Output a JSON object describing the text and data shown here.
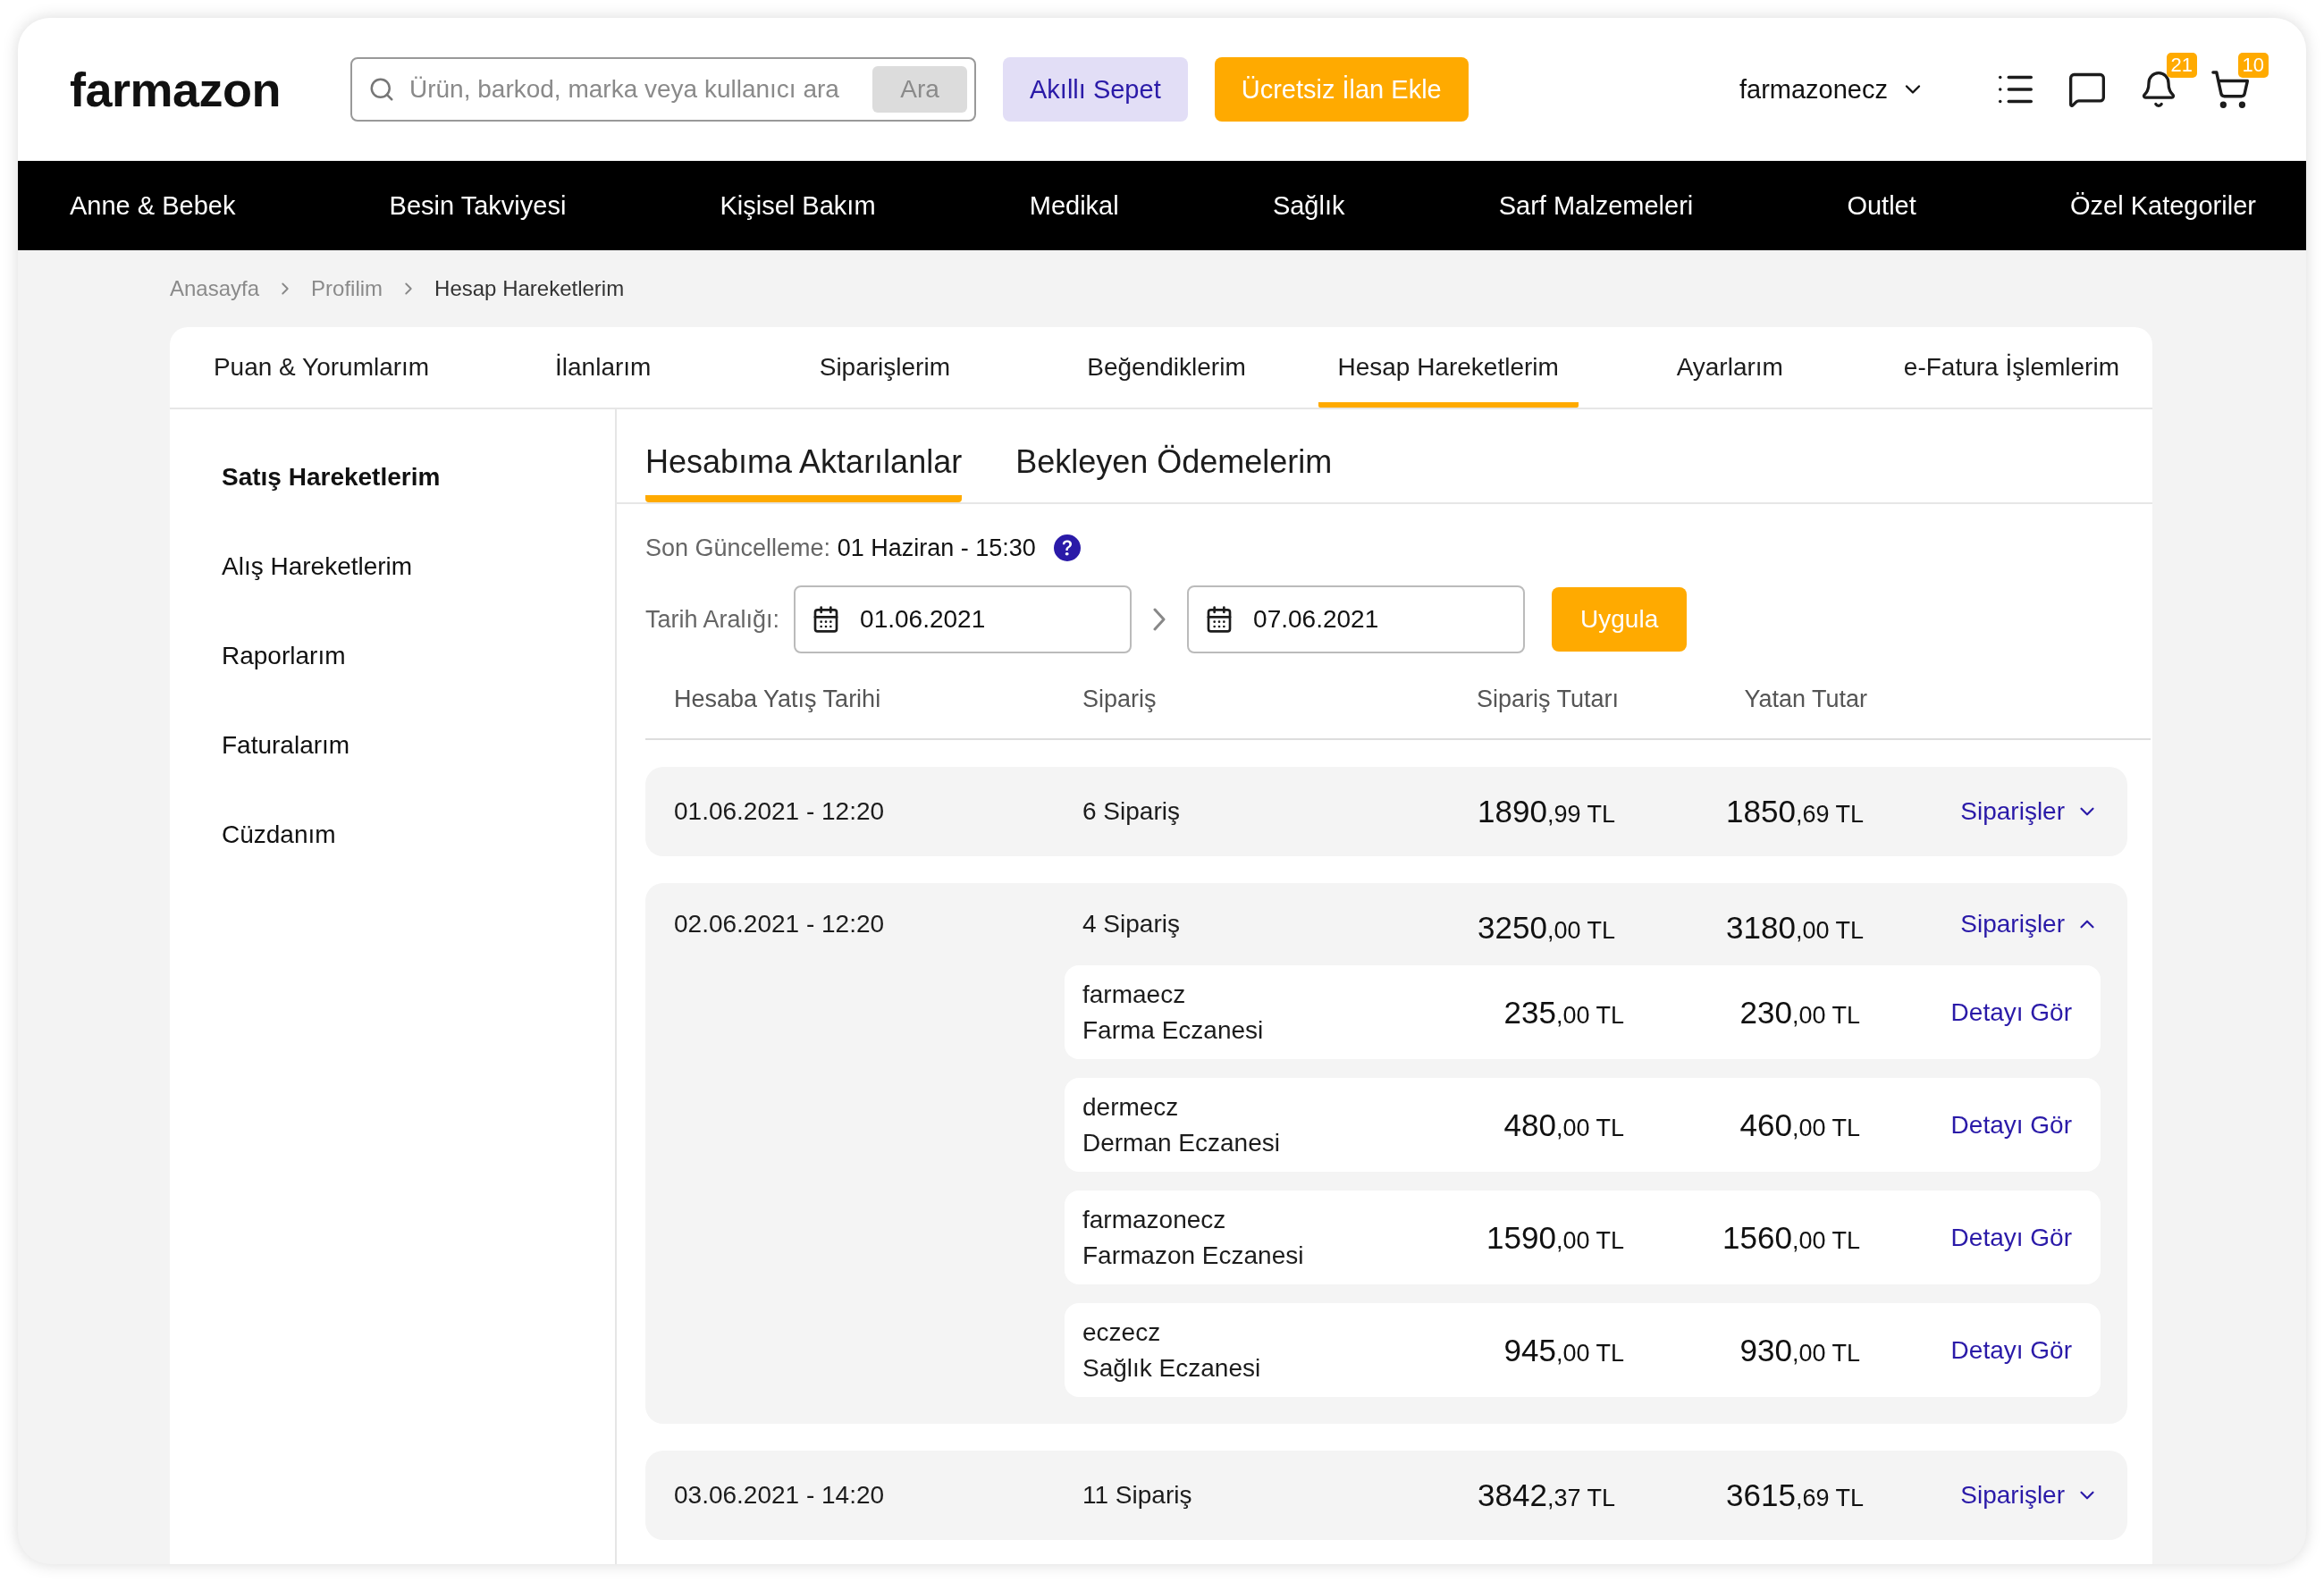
{
  "header": {
    "logo": "farmazon",
    "search": {
      "placeholder": "Ürün, barkod, marka veya kullanıcı ara",
      "button": "Ara"
    },
    "smart_cart": "Akıllı Sepet",
    "add_listing": "Ücretsiz İlan Ekle",
    "user": "farmazonecz",
    "notifications_badge": "21",
    "cart_badge": "10"
  },
  "nav": [
    "Anne & Bebek",
    "Besin Takviyesi",
    "Kişisel Bakım",
    "Medikal",
    "Sağlık",
    "Sarf Malzemeleri",
    "Outlet",
    "Özel Kategoriler"
  ],
  "breadcrumb": [
    {
      "label": "Anasayfa",
      "current": false
    },
    {
      "label": "Profilim",
      "current": false
    },
    {
      "label": "Hesap Hareketlerim",
      "current": true
    }
  ],
  "tabs": [
    {
      "label": "Puan & Yorumlarım",
      "selected": false
    },
    {
      "label": "İlanlarım",
      "selected": false
    },
    {
      "label": "Siparişlerim",
      "selected": false
    },
    {
      "label": "Beğendiklerim",
      "selected": false
    },
    {
      "label": "Hesap Hareketlerim",
      "selected": true
    },
    {
      "label": "Ayarlarım",
      "selected": false
    },
    {
      "label": "e-Fatura İşlemlerim",
      "selected": false
    }
  ],
  "sidebar": {
    "items": [
      {
        "label": "Satış Hareketlerim",
        "selected": true
      },
      {
        "label": "Alış Hareketlerim",
        "selected": false
      },
      {
        "label": "Raporlarım",
        "selected": false
      },
      {
        "label": "Faturalarım",
        "selected": false
      },
      {
        "label": "Cüzdanım",
        "selected": false
      }
    ]
  },
  "subtabs": [
    {
      "label": "Hesabıma Aktarılanlar",
      "selected": true
    },
    {
      "label": "Bekleyen Ödemelerim",
      "selected": false
    }
  ],
  "last_update": {
    "label": "Son Güncelleme:",
    "value": "01 Haziran - 15:30"
  },
  "date_range": {
    "label": "Tarih Aralığı:",
    "start": "01.06.2021",
    "end": "07.06.2021",
    "apply": "Uygula"
  },
  "table": {
    "columns": [
      "Hesaba Yatış Tarihi",
      "Sipariş",
      "Sipariş Tutarı",
      "Yatan Tutar"
    ],
    "rows": [
      {
        "date": "01.06.2021 - 12:20",
        "orders": "6 Sipariş",
        "order_total": {
          "whole": "1890",
          "fraction": ",99 TL"
        },
        "paid": {
          "whole": "1850",
          "fraction": ",69 TL"
        },
        "link": "Siparişler",
        "expanded": false
      },
      {
        "date": "02.06.2021 - 12:20",
        "orders": "4 Sipariş",
        "order_total": {
          "whole": "3250",
          "fraction": ",00 TL"
        },
        "paid": {
          "whole": "3180",
          "fraction": ",00 TL"
        },
        "link": "Siparişler",
        "expanded": true,
        "children": [
          {
            "user": "farmaecz",
            "pharmacy": "Farma Eczanesi",
            "order_total": {
              "whole": "235",
              "fraction": ",00 TL"
            },
            "paid": {
              "whole": "230",
              "fraction": ",00 TL"
            },
            "link": "Detayı Gör"
          },
          {
            "user": "dermecz",
            "pharmacy": "Derman Eczanesi",
            "order_total": {
              "whole": "480",
              "fraction": ",00 TL"
            },
            "paid": {
              "whole": "460",
              "fraction": ",00 TL"
            },
            "link": "Detayı Gör"
          },
          {
            "user": "farmazonecz",
            "pharmacy": "Farmazon Eczanesi",
            "order_total": {
              "whole": "1590",
              "fraction": ",00 TL"
            },
            "paid": {
              "whole": "1560",
              "fraction": ",00 TL"
            },
            "link": "Detayı Gör"
          },
          {
            "user": "eczecz",
            "pharmacy": "Sağlık Eczanesi",
            "order_total": {
              "whole": "945",
              "fraction": ",00 TL"
            },
            "paid": {
              "whole": "930",
              "fraction": ",00 TL"
            },
            "link": "Detayı Gör"
          }
        ]
      },
      {
        "date": "03.06.2021 - 14:20",
        "orders": "11 Sipariş",
        "order_total": {
          "whole": "3842",
          "fraction": ",37 TL"
        },
        "paid": {
          "whole": "3615",
          "fraction": ",69 TL"
        },
        "link": "Siparişler",
        "expanded": false
      }
    ]
  }
}
